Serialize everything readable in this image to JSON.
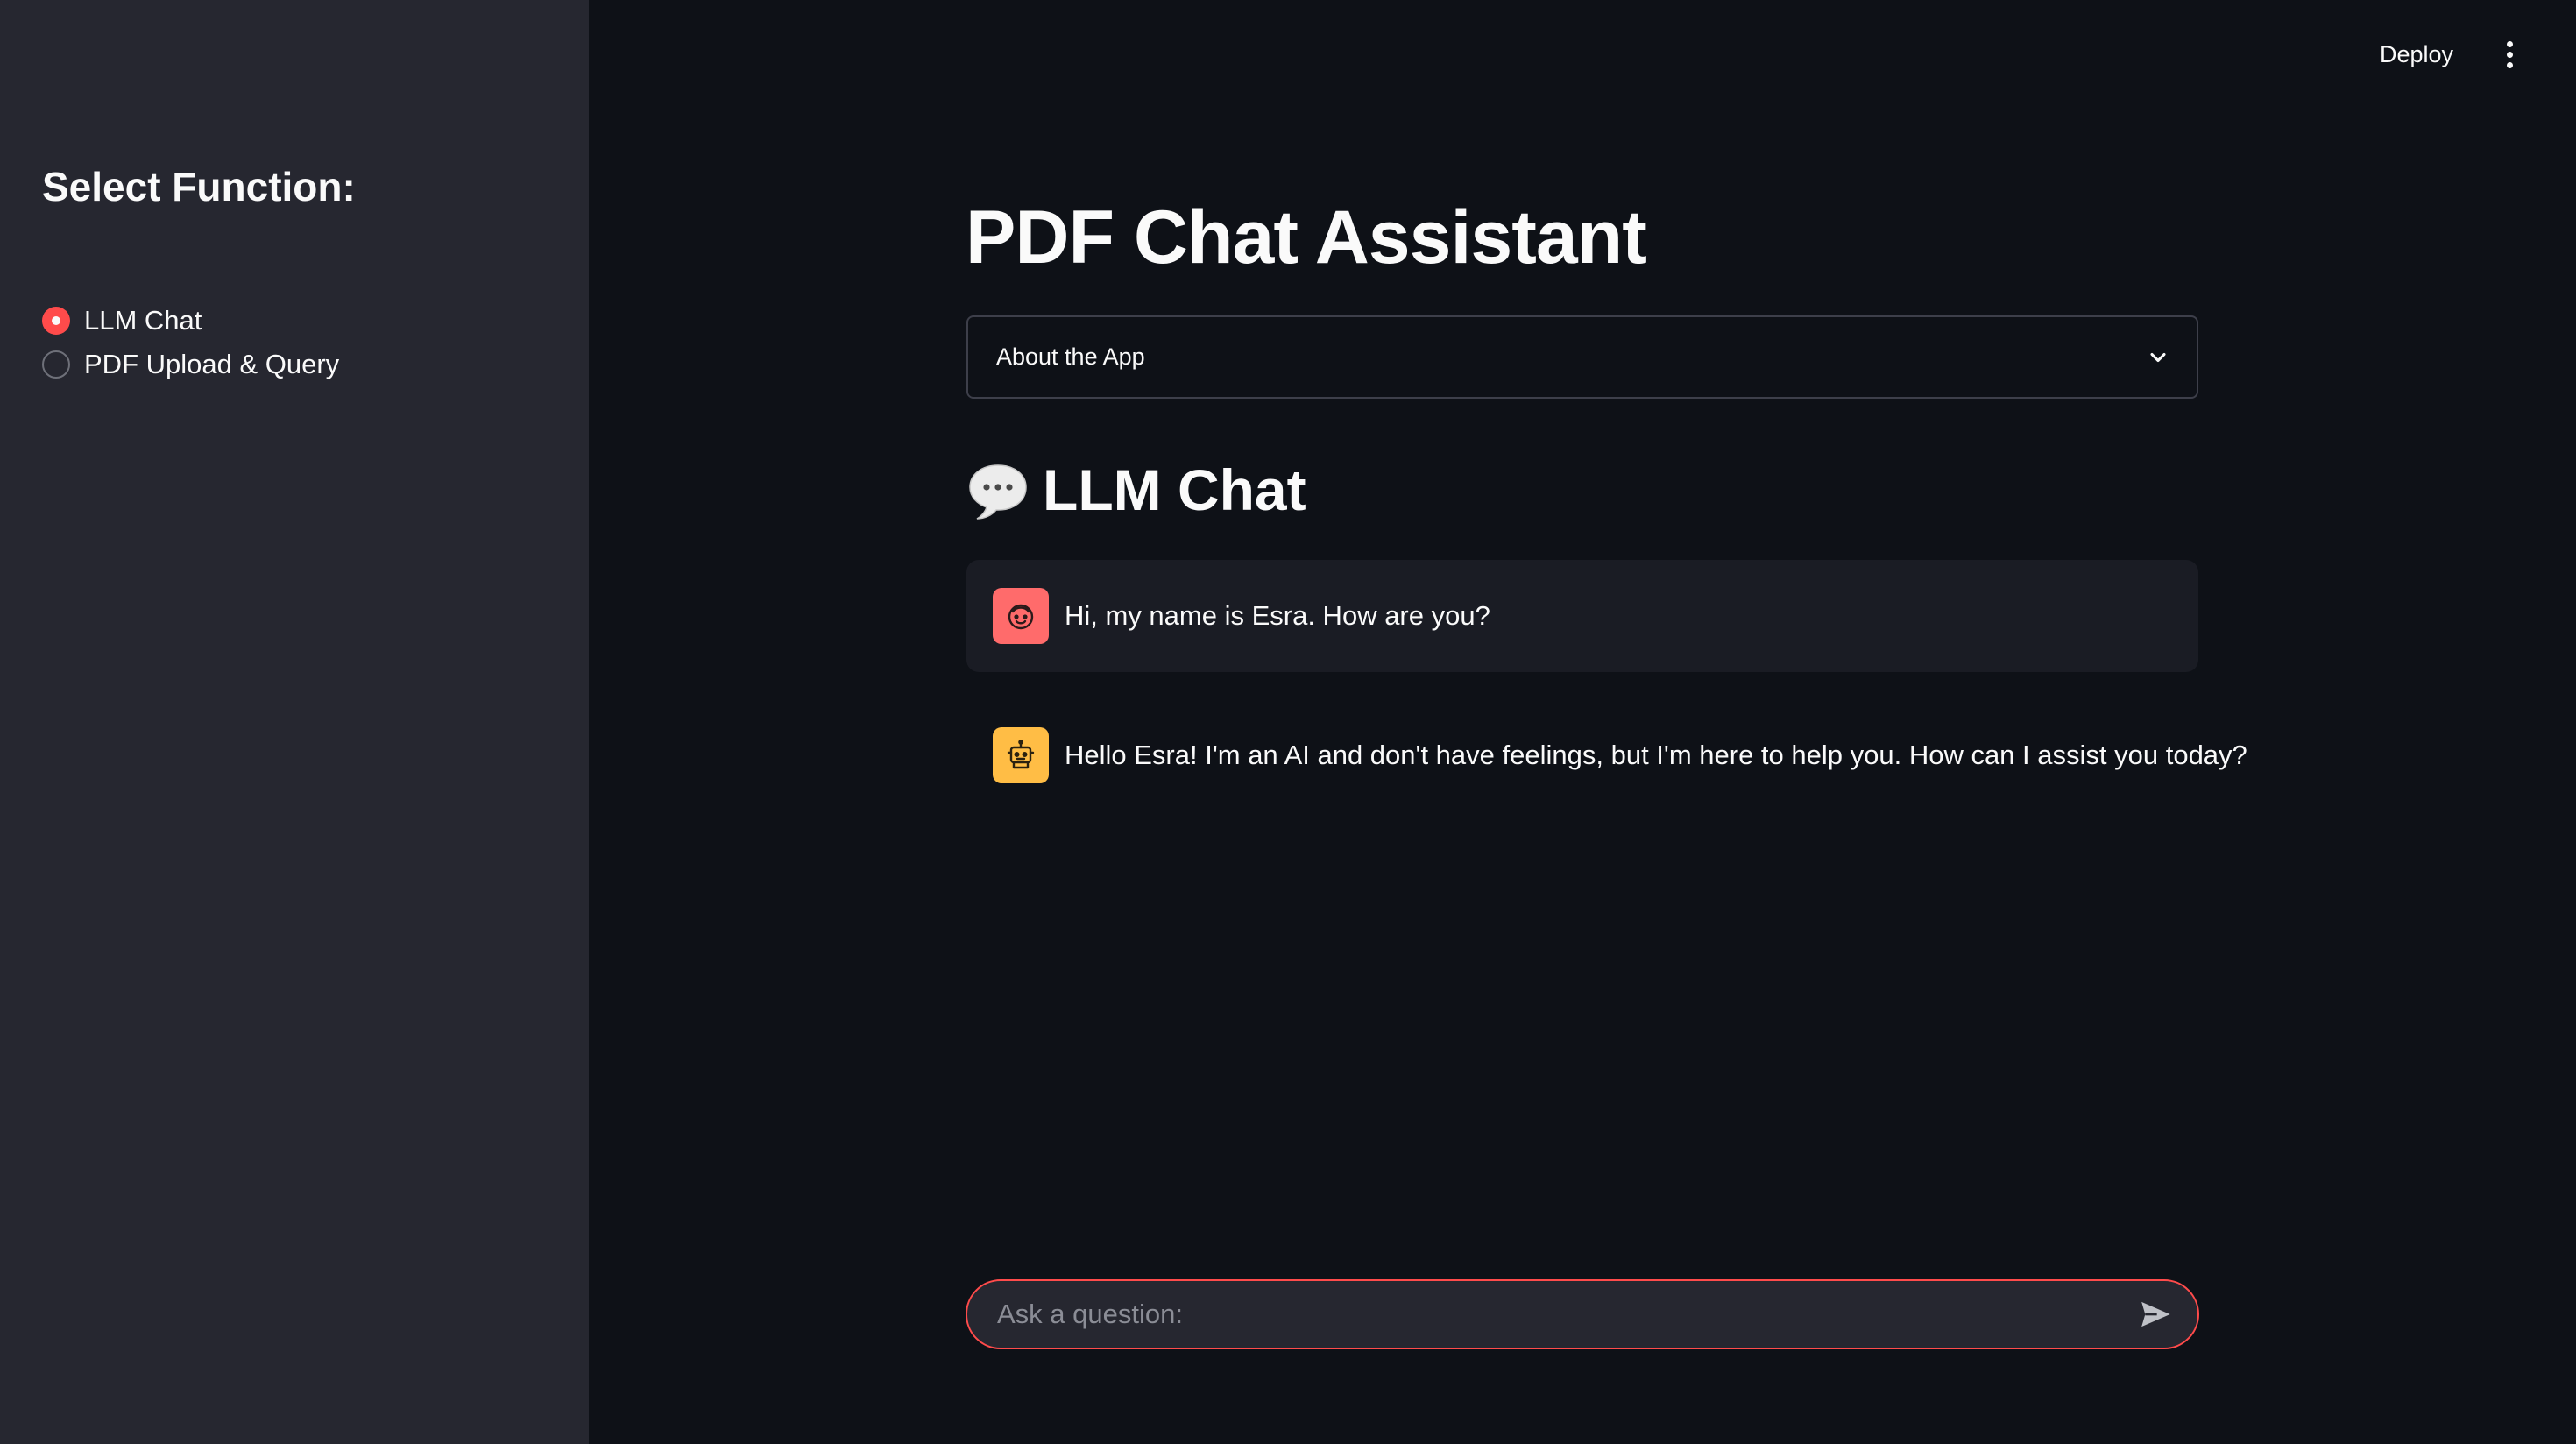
{
  "header": {
    "deploy_label": "Deploy",
    "menu_icon": "vertical-ellipsis-icon"
  },
  "sidebar": {
    "heading": "Select Function:",
    "options": [
      {
        "label": "LLM Chat",
        "selected": true
      },
      {
        "label": "PDF Upload & Query",
        "selected": false
      }
    ]
  },
  "main": {
    "title": "PDF Chat Assistant",
    "expander": {
      "label": "About the App",
      "expanded": false,
      "icon": "chevron-down-icon"
    },
    "section_heading": "LLM Chat",
    "section_icon": "speech-bubble-icon",
    "messages": [
      {
        "role": "user",
        "avatar_icon": "face-icon",
        "text": "Hi, my name is Esra. How are you?"
      },
      {
        "role": "assistant",
        "avatar_icon": "robot-icon",
        "text": "Hello Esra! I'm an AI and don't have feelings, but I'm here to help you. How can I assist you today?"
      }
    ]
  },
  "chat_input": {
    "placeholder": "Ask a question:",
    "value": "",
    "send_icon": "send-icon"
  },
  "colors": {
    "background": "#0e1117",
    "sidebar": "#262730",
    "accent": "#ff4b4b",
    "user_avatar": "#ff6b6b",
    "assistant_avatar": "#ffbd45",
    "text": "#fafafa"
  }
}
